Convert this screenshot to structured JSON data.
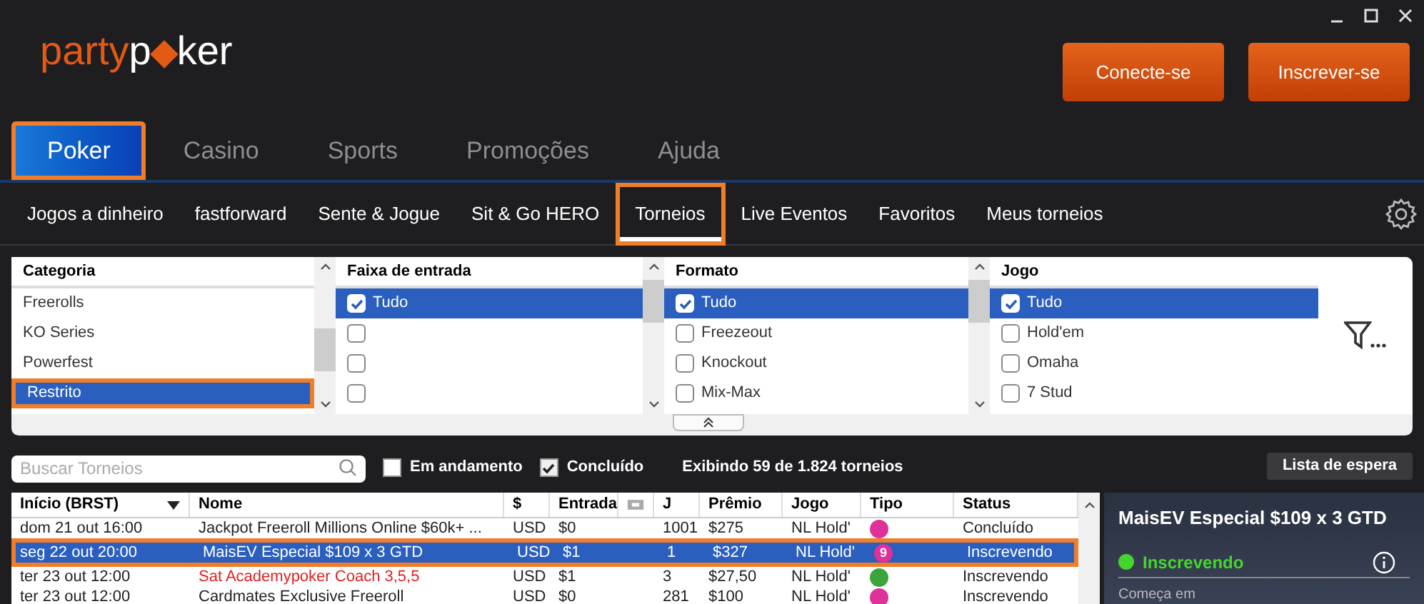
{
  "logo": {
    "part1": "party",
    "part2": "p",
    "part3": "ker"
  },
  "header_buttons": [
    "Conecte-se",
    "Inscrever-se"
  ],
  "main_tabs": [
    {
      "label": "Poker",
      "selected": true,
      "highlighted": true
    },
    {
      "label": "Casino",
      "selected": false,
      "highlighted": false
    },
    {
      "label": "Sports",
      "selected": false,
      "highlighted": false
    },
    {
      "label": "Promoções",
      "selected": false,
      "highlighted": false
    },
    {
      "label": "Ajuda",
      "selected": false,
      "highlighted": false
    }
  ],
  "sub_tabs": [
    {
      "label": "Jogos a dinheiro",
      "selected": false,
      "highlighted": false
    },
    {
      "label": "fastforward",
      "selected": false,
      "highlighted": false
    },
    {
      "label": "Sente & Jogue",
      "selected": false,
      "highlighted": false
    },
    {
      "label": "Sit & Go HERO",
      "selected": false,
      "highlighted": false
    },
    {
      "label": "Torneios",
      "selected": true,
      "highlighted": true
    },
    {
      "label": "Live Eventos",
      "selected": false,
      "highlighted": false
    },
    {
      "label": "Favoritos",
      "selected": false,
      "highlighted": false
    },
    {
      "label": "Meus torneios",
      "selected": false,
      "highlighted": false
    }
  ],
  "filters": [
    {
      "title": "Categoria",
      "kind": "list",
      "items": [
        {
          "label": "Freerolls",
          "selected": false,
          "highlighted": false
        },
        {
          "label": "KO Series",
          "selected": false,
          "highlighted": false
        },
        {
          "label": "Powerfest",
          "selected": false,
          "highlighted": false
        },
        {
          "label": "Restrito",
          "selected": true,
          "highlighted": true
        }
      ]
    },
    {
      "title": "Faixa de entrada",
      "kind": "checklist",
      "items": [
        {
          "label": "Tudo",
          "checked": true,
          "selected": true
        },
        {
          "checked": false,
          "selected": false
        },
        {
          "checked": false,
          "selected": false
        },
        {
          "checked": false,
          "selected": false
        }
      ]
    },
    {
      "title": "Formato",
      "kind": "checklist",
      "items": [
        {
          "label": "Tudo",
          "checked": true,
          "selected": true
        },
        {
          "label": "Freezeout",
          "checked": false,
          "selected": false
        },
        {
          "label": "Knockout",
          "checked": false,
          "selected": false
        },
        {
          "label": "Mix-Max",
          "checked": false,
          "selected": false
        }
      ]
    },
    {
      "title": "Jogo",
      "kind": "checklist",
      "items": [
        {
          "label": "Tudo",
          "checked": true,
          "selected": true
        },
        {
          "label": "Hold'em",
          "checked": false,
          "selected": false
        },
        {
          "label": "Omaha",
          "checked": false,
          "selected": false
        },
        {
          "label": "7 Stud",
          "checked": false,
          "selected": false
        }
      ]
    }
  ],
  "search": {
    "placeholder": "Buscar Torneios"
  },
  "toggles": [
    {
      "label": "Em andamento",
      "checked": false
    },
    {
      "label": "Concluído",
      "checked": true
    }
  ],
  "count_text": "Exibindo 59 de 1.824 torneios",
  "waitlist_button": "Lista de espera",
  "table": {
    "columns": [
      "Início (BRST)",
      "Nome",
      "$",
      "Entrada",
      "",
      "J",
      "Prêmio",
      "Jogo",
      "Tipo",
      "Status"
    ],
    "rows": [
      {
        "cells": [
          "dom 21 out 16:00",
          "Jackpot Freeroll Millions Online $60k+ ...",
          "USD",
          "$0",
          "",
          "1001",
          "$275",
          "NL Hold'",
          "",
          "Concluído"
        ],
        "color": "#e0309a",
        "name_red": false,
        "selected": false,
        "highlighted": false
      },
      {
        "cells": [
          "seg 22 out 20:00",
          "MaisEV Especial $109 x 3 GTD",
          "USD",
          "$1",
          "",
          "1",
          "$327",
          "NL Hold'",
          "9",
          "Inscrevendo"
        ],
        "color": "#e0309a",
        "name_red": false,
        "selected": true,
        "highlighted": true
      },
      {
        "cells": [
          "ter 23 out 12:00",
          "Sat Academypoker Coach 3,5,5",
          "USD",
          "$1",
          "",
          "3",
          "$27,50",
          "NL Hold'",
          "",
          "Inscrevendo"
        ],
        "color": "#3aa53a",
        "name_red": true,
        "selected": false,
        "highlighted": false
      },
      {
        "cells": [
          "ter 23 out 12:00",
          "Cardmates Exclusive Freeroll",
          "USD",
          "$0",
          "",
          "281",
          "$100",
          "NL Hold'",
          "",
          "Inscrevendo"
        ],
        "color": "#e0309a",
        "name_red": false,
        "selected": false,
        "highlighted": false
      }
    ]
  },
  "detail": {
    "title": "MaisEV Especial $109 x 3 GTD",
    "status": "Inscrevendo",
    "color": "#44d62c",
    "starts_label": "Começa em"
  }
}
